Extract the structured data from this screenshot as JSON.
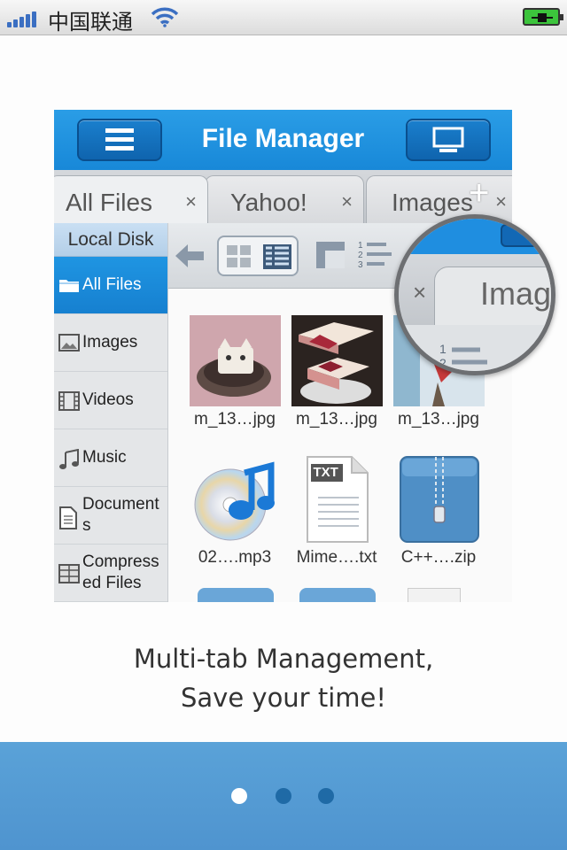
{
  "status_bar": {
    "carrier": "中国联通"
  },
  "app": {
    "title": "File Manager",
    "tabs": [
      {
        "label": "All Files",
        "close": "×"
      },
      {
        "label": "Yahoo!",
        "close": "×"
      },
      {
        "label": "Images",
        "close": "×"
      }
    ],
    "add_tab_label": "+",
    "sidebar": {
      "header": "Local Disk",
      "items": [
        {
          "label": "All Files",
          "icon": "folder-icon",
          "active": true
        },
        {
          "label": "Images",
          "icon": "image-icon"
        },
        {
          "label": "Videos",
          "icon": "film-icon"
        },
        {
          "label": "Music",
          "icon": "music-note-icon"
        },
        {
          "label": "Document s",
          "icon": "document-icon"
        },
        {
          "label": "Compress ed Files",
          "icon": "archive-icon"
        }
      ]
    },
    "files": [
      {
        "name": "m_13…jpg",
        "kind": "photo"
      },
      {
        "name": "m_13…jpg",
        "kind": "photo"
      },
      {
        "name": "m_13…jpg",
        "kind": "photo"
      },
      {
        "name": "02….mp3",
        "kind": "audio"
      },
      {
        "name": "Mime….txt",
        "kind": "text",
        "badge": "TXT"
      },
      {
        "name": "C++….zip",
        "kind": "zip"
      }
    ],
    "magnifier": {
      "tab_label": "Image",
      "close": "×"
    }
  },
  "caption": {
    "line1": "Multi-tab Management,",
    "line2": "Save your time!"
  },
  "pager": {
    "count": 3,
    "active_index": 0
  },
  "colors": {
    "accent": "#1a8ad9",
    "footer": "#57a0d7"
  }
}
